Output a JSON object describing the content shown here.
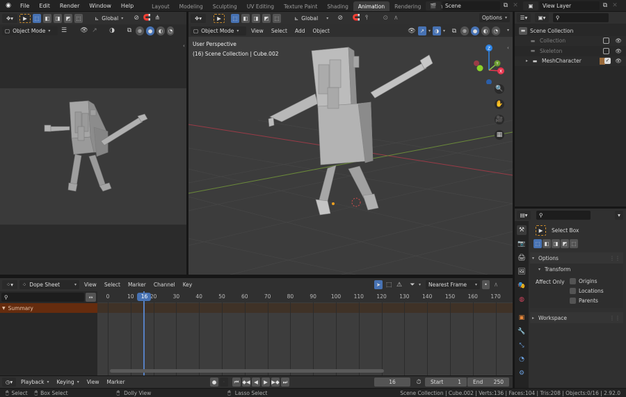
{
  "topbar": {
    "menus": [
      "File",
      "Edit",
      "Render",
      "Window",
      "Help"
    ],
    "workspaces": [
      {
        "label": "Layout",
        "active": false
      },
      {
        "label": "Modeling",
        "active": false
      },
      {
        "label": "Sculpting",
        "active": false
      },
      {
        "label": "UV Editing",
        "active": false
      },
      {
        "label": "Texture Paint",
        "active": false
      },
      {
        "label": "Shading",
        "active": false
      },
      {
        "label": "Animation",
        "active": true
      },
      {
        "label": "Rendering",
        "active": false
      },
      {
        "label": "Compositing",
        "active": false
      }
    ],
    "scene": "Scene",
    "view_layer": "View Layer"
  },
  "left_viewport": {
    "transform_orientation": "Global",
    "mode": "Object Mode"
  },
  "main_viewport": {
    "transform_orientation": "Global",
    "mode": "Object Mode",
    "menus": [
      "View",
      "Select",
      "Add",
      "Object"
    ],
    "options_label": "Options",
    "overlay_line1": "User Perspective",
    "overlay_line2": "(16) Scene Collection | Cube.002",
    "gizmo": {
      "z": "Z",
      "y": "Y",
      "x": "X"
    },
    "colors": {
      "x_axis": "#e8364f",
      "y_axis": "#8bc34a",
      "z_axis": "#2f86e8",
      "grid_x": "#9a3b47",
      "grid_y": "#6b8a3a"
    }
  },
  "outliner": {
    "root": "Scene Collection",
    "items": [
      {
        "label": "Collection",
        "dimmed": true,
        "checked": false
      },
      {
        "label": "Skeleton",
        "dimmed": true,
        "checked": false
      },
      {
        "label": "MeshCharacter",
        "dimmed": false,
        "checked": true
      }
    ]
  },
  "properties": {
    "tool_name": "Select Box",
    "options_label": "Options",
    "transform_label": "Transform",
    "affect_only_label": "Affect Only",
    "checkboxes": [
      "Origins",
      "Locations",
      "Parents"
    ],
    "workspace_label": "Workspace"
  },
  "dopesheet": {
    "editor_type": "Dope Sheet",
    "menus": [
      "View",
      "Select",
      "Marker",
      "Channel",
      "Key"
    ],
    "snapping": "Nearest Frame",
    "summary_label": "Summary",
    "current_frame": "16",
    "ticks": [
      "0",
      "10",
      "20",
      "30",
      "40",
      "50",
      "60",
      "70",
      "80",
      "90",
      "100",
      "110",
      "120",
      "130",
      "140",
      "150",
      "160",
      "170"
    ]
  },
  "timeline": {
    "menus": [
      "Playback",
      "Keying",
      "View",
      "Marker"
    ],
    "current_frame": "16",
    "start_label": "Start",
    "start_value": "1",
    "end_label": "End",
    "end_value": "250"
  },
  "statusbar": {
    "hints": [
      "Select",
      "Box Select",
      "Dolly View",
      "Lasso Select"
    ],
    "info": "Scene Collection | Cube.002 | Verts:136 | Faces:104 | Tris:208 | Objects:0/16 | 2.92.0"
  }
}
